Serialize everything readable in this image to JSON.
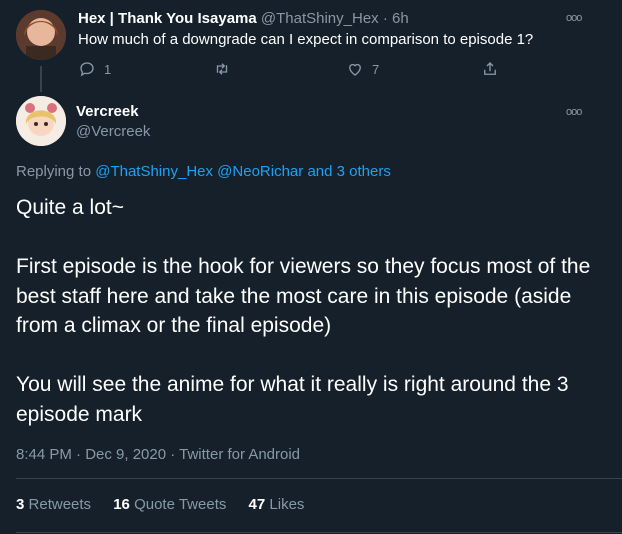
{
  "reply_tweet": {
    "name": "Hex | Thank You Isayama",
    "handle": "@ThatShiny_Hex",
    "dot": "·",
    "time": "6h",
    "text": "How much of a downgrade can I expect in comparison to episode 1?",
    "replies": "1",
    "retweets": "",
    "likes": "7"
  },
  "main_tweet": {
    "name": "Vercreek",
    "handle": "@Vercreek",
    "replying_prefix": "Replying to",
    "replying_user1": "@ThatShiny_Hex",
    "replying_user2": "@NeoRichar",
    "replying_others": "and 3 others",
    "paragraph1": "Quite a lot~",
    "paragraph2": "First episode is the hook for viewers so they focus most of the best staff here and take the most care in this episode (aside from a climax or the final episode)",
    "paragraph3": "You will see the anime for what it really is right around the 3 episode mark",
    "timestamp": "8:44 PM · Dec 9, 2020 · Twitter for Android"
  },
  "stats": {
    "retweets_count": "3",
    "retweets_label": "Retweets",
    "quotes_count": "16",
    "quotes_label": "Quote Tweets",
    "likes_count": "47",
    "likes_label": "Likes"
  },
  "more_glyph": "ooo",
  "colors": {
    "background": "#15202b",
    "text": "#ffffff",
    "muted": "#8899a6",
    "link": "#1da1f2",
    "divider": "#38444d"
  },
  "icons": [
    "reply-icon",
    "retweet-icon",
    "like-icon",
    "share-icon",
    "more-icon"
  ]
}
